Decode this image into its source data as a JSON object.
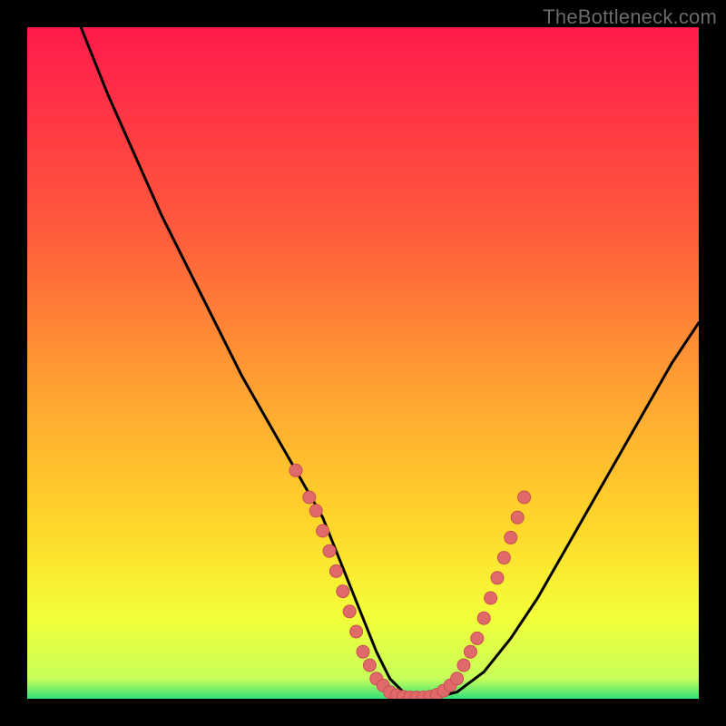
{
  "watermark": "TheBottleneck.com",
  "colors": {
    "gradient": [
      "#ff1a4b",
      "#ff5a3c",
      "#ffa531",
      "#ffd92a",
      "#f3ff3a",
      "#c6ff59",
      "#34e07a"
    ],
    "curve_stroke": "#000000",
    "point_fill": "#e06a6a",
    "point_stroke": "#c94f4f"
  },
  "chart_data": {
    "type": "line",
    "title": "",
    "xlabel": "",
    "ylabel": "",
    "xlim": [
      0,
      100
    ],
    "ylim": [
      0,
      100
    ],
    "series": [
      {
        "name": "curve",
        "x": [
          8,
          12,
          16,
          20,
          24,
          28,
          32,
          36,
          40,
          44,
          46,
          48,
          50,
          52,
          54,
          56,
          58,
          60,
          64,
          68,
          72,
          76,
          80,
          84,
          88,
          92,
          96,
          100
        ],
        "values": [
          100,
          90,
          81,
          72,
          64,
          56,
          48,
          41,
          34,
          27,
          22,
          17,
          12,
          7,
          3,
          1,
          0,
          0,
          1,
          4,
          9,
          15,
          22,
          29,
          36,
          43,
          50,
          56
        ]
      }
    ],
    "points": [
      {
        "x": 40,
        "y": 34
      },
      {
        "x": 42,
        "y": 30
      },
      {
        "x": 43,
        "y": 28
      },
      {
        "x": 44,
        "y": 25
      },
      {
        "x": 45,
        "y": 22
      },
      {
        "x": 46,
        "y": 19
      },
      {
        "x": 47,
        "y": 16
      },
      {
        "x": 48,
        "y": 13
      },
      {
        "x": 49,
        "y": 10
      },
      {
        "x": 50,
        "y": 7
      },
      {
        "x": 51,
        "y": 5
      },
      {
        "x": 52,
        "y": 3
      },
      {
        "x": 53,
        "y": 2
      },
      {
        "x": 54,
        "y": 1
      },
      {
        "x": 55,
        "y": 0.5
      },
      {
        "x": 56,
        "y": 0.3
      },
      {
        "x": 57,
        "y": 0.2
      },
      {
        "x": 58,
        "y": 0.2
      },
      {
        "x": 59,
        "y": 0.2
      },
      {
        "x": 60,
        "y": 0.3
      },
      {
        "x": 61,
        "y": 0.6
      },
      {
        "x": 62,
        "y": 1.2
      },
      {
        "x": 63,
        "y": 2
      },
      {
        "x": 64,
        "y": 3
      },
      {
        "x": 65,
        "y": 5
      },
      {
        "x": 66,
        "y": 7
      },
      {
        "x": 67,
        "y": 9
      },
      {
        "x": 68,
        "y": 12
      },
      {
        "x": 69,
        "y": 15
      },
      {
        "x": 70,
        "y": 18
      },
      {
        "x": 71,
        "y": 21
      },
      {
        "x": 72,
        "y": 24
      },
      {
        "x": 73,
        "y": 27
      },
      {
        "x": 74,
        "y": 30
      }
    ]
  }
}
